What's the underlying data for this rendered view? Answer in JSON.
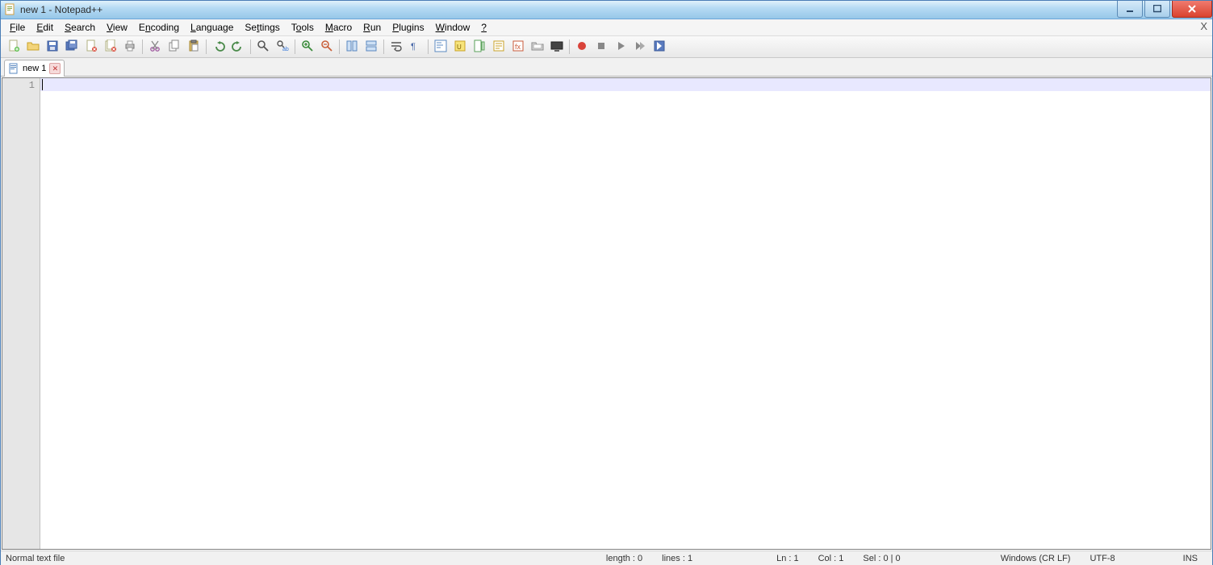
{
  "window": {
    "title": "new 1 - Notepad++"
  },
  "menubar": {
    "items": [
      {
        "label": "File",
        "u": "F"
      },
      {
        "label": "Edit",
        "u": "E"
      },
      {
        "label": "Search",
        "u": "S"
      },
      {
        "label": "View",
        "u": "V"
      },
      {
        "label": "Encoding",
        "u": "E"
      },
      {
        "label": "Language",
        "u": "L"
      },
      {
        "label": "Settings",
        "u": "S"
      },
      {
        "label": "Tools",
        "u": "T"
      },
      {
        "label": "Macro",
        "u": "M"
      },
      {
        "label": "Run",
        "u": "R"
      },
      {
        "label": "Plugins",
        "u": "P"
      },
      {
        "label": "Window",
        "u": "W"
      },
      {
        "label": "?",
        "u": "?"
      }
    ],
    "close": "X"
  },
  "toolbar": {
    "icons": [
      "new-file-icon",
      "open-file-icon",
      "save-icon",
      "save-all-icon",
      "close-file-icon",
      "close-all-icon",
      "print-icon",
      "sep",
      "cut-icon",
      "copy-icon",
      "paste-icon",
      "sep",
      "undo-icon",
      "redo-icon",
      "sep",
      "find-icon",
      "replace-icon",
      "sep",
      "zoom-in-icon",
      "zoom-out-icon",
      "sep",
      "sync-v-icon",
      "sync-h-icon",
      "sep",
      "word-wrap-icon",
      "show-all-chars-icon",
      "sep",
      "indent-guide-icon",
      "udl-icon",
      "doc-map-icon",
      "doc-list-icon",
      "function-list-icon",
      "folder-workspace-icon",
      "monitoring-icon",
      "sep",
      "record-macro-icon",
      "stop-macro-icon",
      "play-macro-icon",
      "play-multi-icon",
      "save-macro-icon"
    ]
  },
  "tabs": [
    {
      "label": "new 1"
    }
  ],
  "editor": {
    "line_numbers": [
      "1"
    ]
  },
  "statusbar": {
    "file_type": "Normal text file",
    "length": "length : 0",
    "lines": "lines : 1",
    "ln": "Ln : 1",
    "col": "Col : 1",
    "sel": "Sel : 0 | 0",
    "eol": "Windows (CR LF)",
    "encoding": "UTF-8",
    "mode": "INS"
  }
}
